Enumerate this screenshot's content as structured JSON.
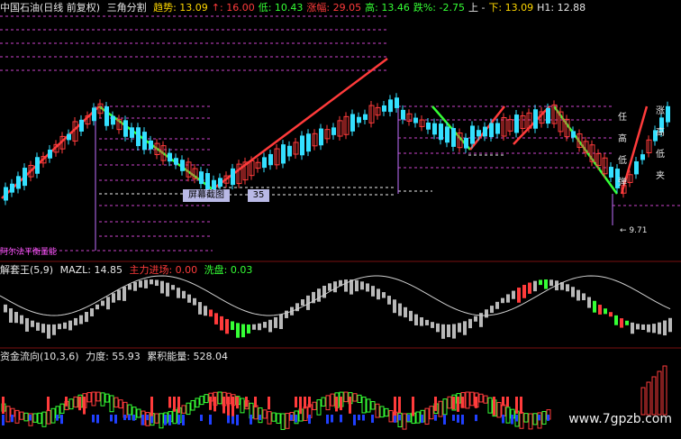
{
  "header": {
    "stock": "中国石油(日线 前复权)",
    "indicator": "三角分割",
    "fields": [
      {
        "label": "趋势:",
        "value": "13.09",
        "cls": "yellow"
      },
      {
        "label": "↑:",
        "value": "16.00",
        "cls": "red"
      },
      {
        "label": "低:",
        "value": "10.43",
        "cls": "green"
      },
      {
        "label": "涨幅:",
        "value": "29.05",
        "cls": "red"
      },
      {
        "label": "高:",
        "value": "13.46",
        "cls": "green"
      },
      {
        "label": "跌%:",
        "value": "-2.75",
        "cls": "green"
      },
      {
        "label": "上",
        "value": "-",
        "cls": "white"
      },
      {
        "label": "下:",
        "value": "13.09",
        "cls": "yellow"
      },
      {
        "label": "H1:",
        "value": "12.88",
        "cls": "white"
      }
    ]
  },
  "overlay": {
    "button": "屏幕截图",
    "label": "35"
  },
  "sub_labels": {
    "left_small": "阿尔法平衡量能"
  },
  "price_labels": [
    "9.71"
  ],
  "vertical_tags": [
    "任",
    "高",
    "低",
    "弹"
  ],
  "vertical_tags_right": [
    "涨",
    "高",
    "低",
    "夹"
  ],
  "panel2": {
    "title": "解套王(5,9)",
    "mazl": "MAZL: 14.85",
    "inflow": "主力进场: 0.00",
    "wash": "洗盘: 0.03"
  },
  "panel3": {
    "title": "资金流向(10,3,6)",
    "strength": "力度: 55.93",
    "accum": "累积能量: 528.04"
  },
  "watermark": "www.7gpzb.com",
  "colors": {
    "bg": "#000000",
    "green": "#35ff35",
    "red": "#ff3b3b",
    "cyan": "#34e0ff",
    "magenta": "#ff55ff",
    "purple": "#c070ff"
  }
}
